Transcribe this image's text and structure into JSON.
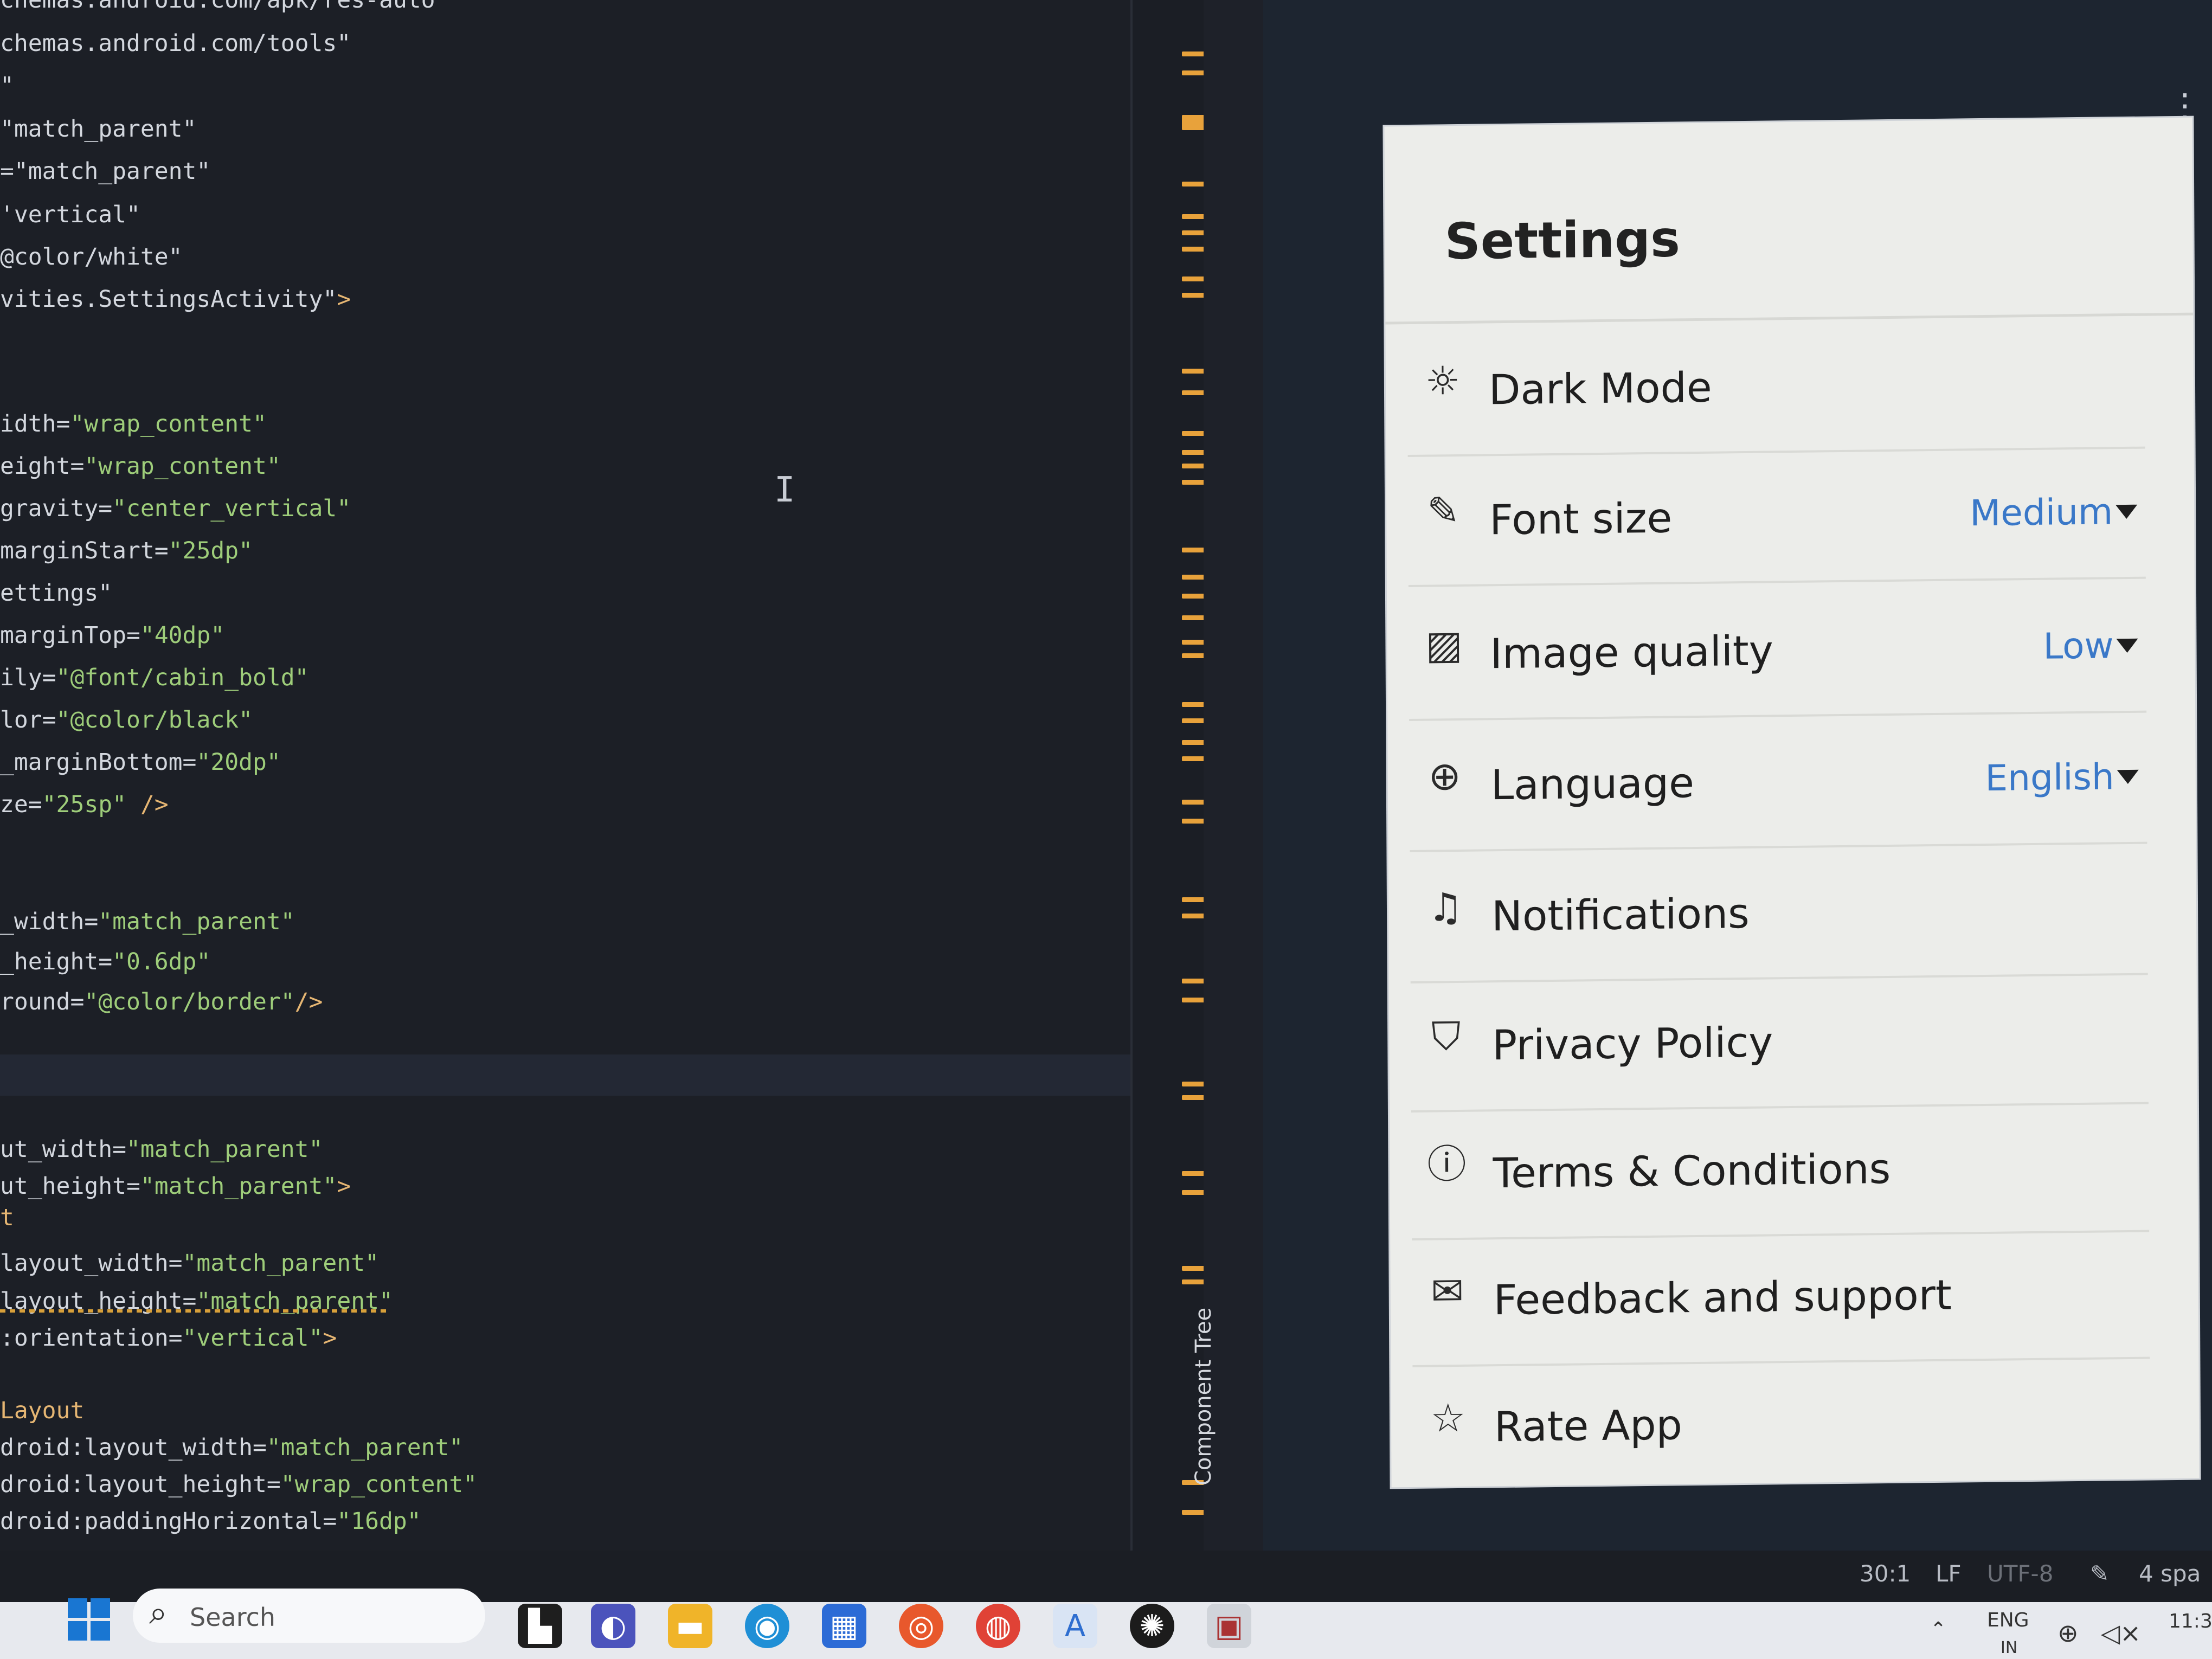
{
  "editor": {
    "lines": [
      {
        "attr": "chemas.android.com/apk/res-auto",
        "str": "",
        "rest": ""
      },
      {
        "attr": "chemas.android.com/tools\"",
        "str": "",
        "rest": ""
      },
      {
        "attr": "\"",
        "str": "",
        "rest": ""
      },
      {
        "attr": "\"match_parent\"",
        "str": "",
        "rest": ""
      },
      {
        "attr": "=\"match_parent\"",
        "str": "",
        "rest": ""
      },
      {
        "attr": "'vertical\"",
        "str": "",
        "rest": ""
      },
      {
        "attr": "@color/white\"",
        "str": "",
        "rest": ""
      },
      {
        "attr": "vities.SettingsActivity\"",
        "str": "",
        "rest": ">"
      },
      {
        "attr": "idth=",
        "str": "\"wrap_content\"",
        "rest": ""
      },
      {
        "attr": "eight=",
        "str": "\"wrap_content\"",
        "rest": ""
      },
      {
        "attr": "gravity=",
        "str": "\"center_vertical\"",
        "rest": ""
      },
      {
        "attr": "marginStart=",
        "str": "\"25dp\"",
        "rest": ""
      },
      {
        "attr": "ettings\"",
        "str": "",
        "rest": ""
      },
      {
        "attr": "marginTop=",
        "str": "\"40dp\"",
        "rest": ""
      },
      {
        "attr": "ily=",
        "str": "\"@font/cabin_bold\"",
        "rest": ""
      },
      {
        "attr": "lor=",
        "str": "\"@color/black\"",
        "rest": ""
      },
      {
        "attr": "_marginBottom=",
        "str": "\"20dp\"",
        "rest": ""
      },
      {
        "attr": "ze=",
        "str": "\"25sp\"",
        "rest": " />"
      },
      {
        "attr": "_width=",
        "str": "\"match_parent\"",
        "rest": ""
      },
      {
        "attr": "_height=",
        "str": "\"0.6dp\"",
        "rest": ""
      },
      {
        "attr": "round=",
        "str": "\"@color/border\"",
        "rest": "/>"
      },
      {
        "attr": "ut_width=",
        "str": "\"match_parent\"",
        "rest": ""
      },
      {
        "attr": "ut_height=",
        "str": "\"match_parent\"",
        "rest": ">"
      },
      {
        "attr": "",
        "str": "",
        "rest": "t"
      },
      {
        "attr": "layout_width=",
        "str": "\"match_parent\"",
        "rest": ""
      },
      {
        "attr": "layout_height=",
        "str": "\"match_parent\"",
        "rest": ""
      },
      {
        "attr": ":orientation=",
        "str": "\"vertical\"",
        "rest": ">"
      },
      {
        "attr": "",
        "str": "",
        "rest": "Layout"
      },
      {
        "attr": "droid:layout_width=",
        "str": "\"match_parent\"",
        "rest": ""
      },
      {
        "attr": "droid:layout_height=",
        "str": "\"wrap_content\"",
        "rest": ""
      },
      {
        "attr": "droid:paddingHorizontal=",
        "str": "\"16dp\"",
        "rest": ""
      }
    ],
    "caret": "I"
  },
  "side_panel": {
    "component_tree_label": "Component Tree",
    "menu_glyph": "⋮"
  },
  "app": {
    "title": "Settings",
    "rows": [
      {
        "label": "Dark Mode",
        "icon": "sun-icon",
        "glyph": "☼",
        "value": ""
      },
      {
        "label": "Font size",
        "icon": "edit-icon",
        "glyph": "✎",
        "value": "Medium"
      },
      {
        "label": "Image quality",
        "icon": "image-icon",
        "glyph": "▨",
        "value": "Low"
      },
      {
        "label": "Language",
        "icon": "globe-icon",
        "glyph": "⊕",
        "value": "English"
      },
      {
        "label": "Notifications",
        "icon": "bell-icon",
        "glyph": "♫",
        "value": ""
      },
      {
        "label": "Privacy Policy",
        "icon": "shield-icon",
        "glyph": "⛉",
        "value": ""
      },
      {
        "label": "Terms & Conditions",
        "icon": "info-icon",
        "glyph": "ⓘ",
        "value": ""
      },
      {
        "label": "Feedback and support",
        "icon": "mail-icon",
        "glyph": "✉",
        "value": ""
      },
      {
        "label": "Rate App",
        "icon": "star-icon",
        "glyph": "☆",
        "value": ""
      }
    ],
    "accent_color": "#3a78c8"
  },
  "status_bar": {
    "position": "30:1",
    "line_ending": "LF",
    "encoding": "UTF-8",
    "indent": "4 spa"
  },
  "taskbar": {
    "search_placeholder": "Search",
    "language": "ENG",
    "region": "IN",
    "clock": "11:3"
  }
}
